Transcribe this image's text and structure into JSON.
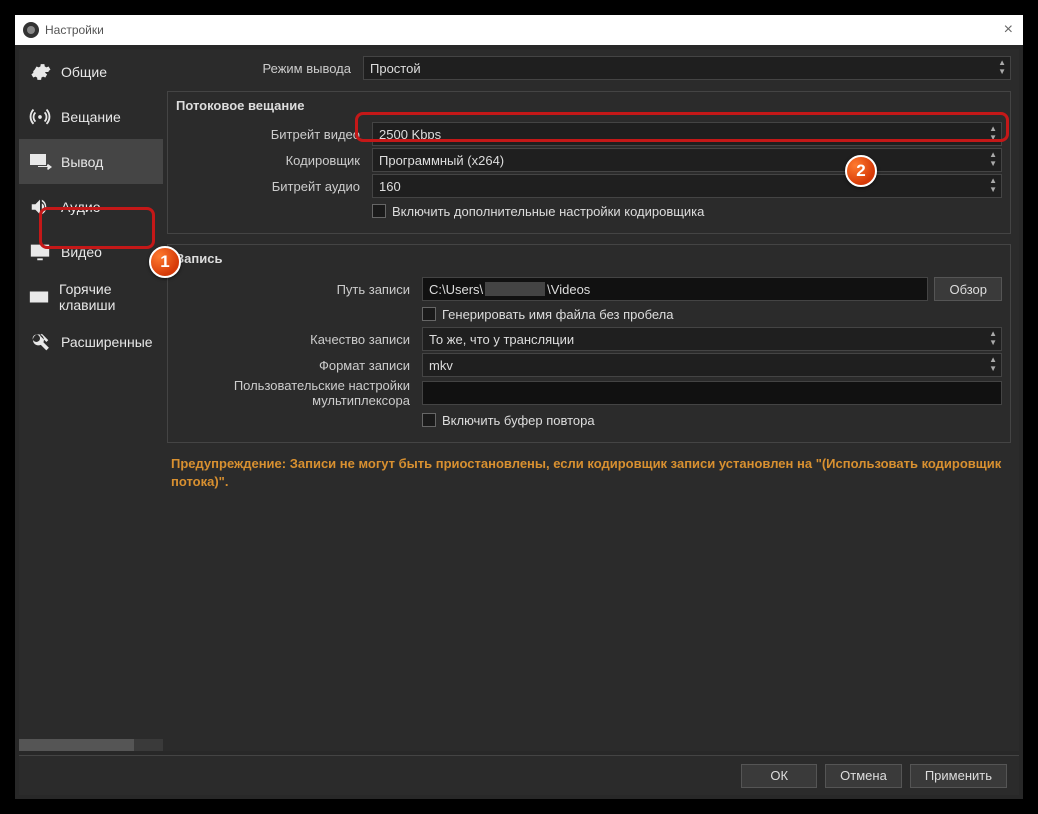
{
  "window": {
    "title": "Настройки"
  },
  "sidebar": {
    "items": [
      {
        "label": "Общие"
      },
      {
        "label": "Вещание"
      },
      {
        "label": "Вывод"
      },
      {
        "label": "Аудио"
      },
      {
        "label": "Видео"
      },
      {
        "label": "Горячие клавиши"
      },
      {
        "label": "Расширенные"
      }
    ]
  },
  "main": {
    "output_mode_label": "Режим вывода",
    "output_mode_value": "Простой",
    "streaming": {
      "title": "Потоковое вещание",
      "video_bitrate_label": "Битрейт видео",
      "video_bitrate_value": "2500 Kbps",
      "encoder_label": "Кодировщик",
      "encoder_value": "Программный (x264)",
      "audio_bitrate_label": "Битрейт аудио",
      "audio_bitrate_value": "160",
      "adv_checkbox_label": "Включить дополнительные настройки кодировщика"
    },
    "recording": {
      "title": "Запись",
      "path_label": "Путь записи",
      "path_value_prefix": "C:\\Users\\",
      "path_value_suffix": "\\Videos",
      "browse_label": "Обзор",
      "gen_filename_label": "Генерировать имя файла без пробела",
      "quality_label": "Качество записи",
      "quality_value": "То же, что у трансляции",
      "format_label": "Формат записи",
      "format_value": "mkv",
      "mux_label": "Пользовательские настройки мультиплексора",
      "replay_buffer_label": "Включить буфер повтора"
    },
    "warning": "Предупреждение: Записи не могут быть приостановлены, если кодировщик записи установлен на \"(Использовать кодировщик потока)\"."
  },
  "footer": {
    "ok": "ОК",
    "cancel": "Отмена",
    "apply": "Применить"
  },
  "badges": {
    "one": "1",
    "two": "2"
  }
}
